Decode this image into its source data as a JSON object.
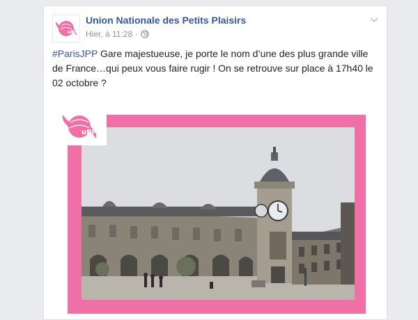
{
  "post": {
    "page_name": "Union Nationale des Petits Plaisirs",
    "timestamp": "Hier, à 11:28",
    "separator": "·",
    "hashtag": "#ParisJPP",
    "body_text": " Gare majestueuse, je porte le nom d’une des plus grande ville de France…qui peux vous faire rugir ! On se retrouve sur place à 17h40 le 02 octobre ?"
  },
  "icons": {
    "avatar": "upp-logo-icon",
    "privacy": "globe-icon",
    "menu": "chevron-down-icon"
  },
  "logo": {
    "text": "uPP"
  },
  "colors": {
    "link_blue": "#365899",
    "brand_pink": "#f06fa6",
    "meta_grey": "#90949c"
  }
}
